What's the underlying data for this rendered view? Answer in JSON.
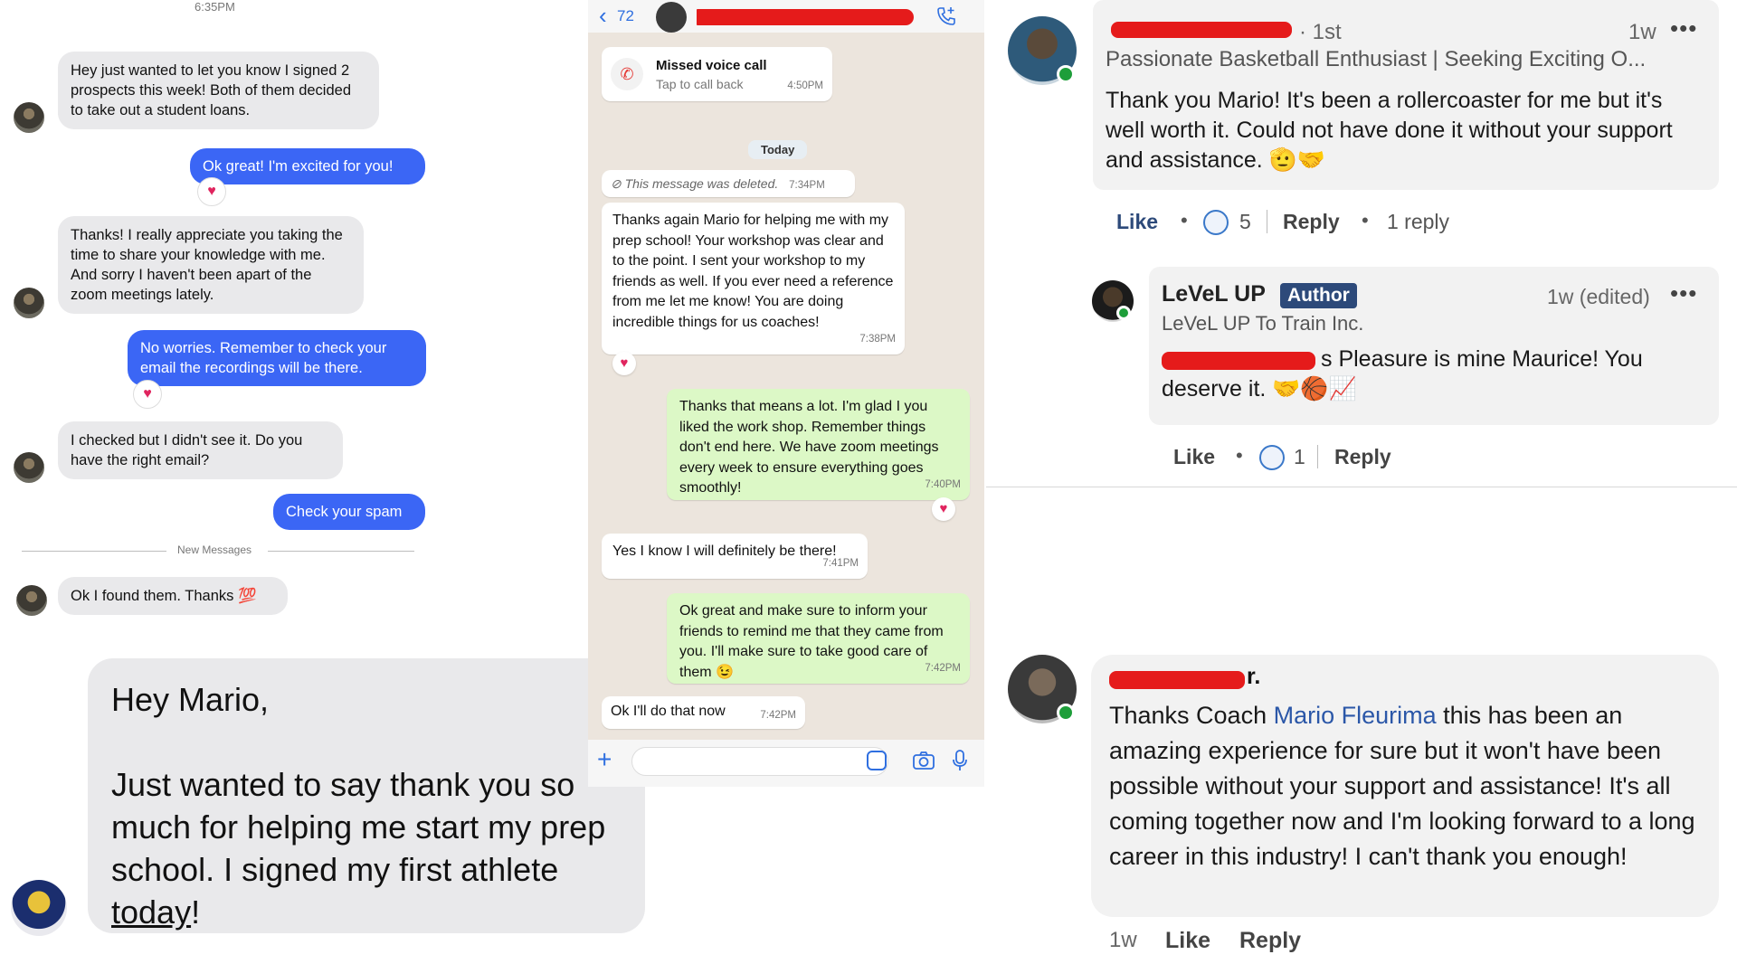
{
  "imessage": {
    "time": "6:35PM",
    "messages": [
      {
        "text": "Hey just wanted to let you know I signed 2 prospects this week! Both of them decided to take out a student loans."
      },
      {
        "text": "Ok great! I'm excited for you!"
      },
      {
        "text": "Thanks! I really appreciate you taking the time to share your knowledge with me. And sorry I haven't been apart of the zoom meetings lately."
      },
      {
        "text": "No worries. Remember to check your email the recordings will be there."
      },
      {
        "text": "I checked but I didn't see it. Do you have the right email?"
      },
      {
        "text": "Check your spam"
      },
      {
        "text": "Ok I found them. Thanks 💯"
      }
    ],
    "divider": "New Messages"
  },
  "large_message": {
    "greeting": "Hey Mario,",
    "body": "Just wanted to say thank you so much for helping me start my prep school. I signed my first athlete",
    "link": "today",
    "end": "!"
  },
  "whatsapp": {
    "back_count": "72",
    "missed_call": {
      "title": "Missed voice call",
      "sub": "Tap to call back",
      "time": "4:50PM"
    },
    "date_chip": "Today",
    "deleted": {
      "text": "This message was deleted.",
      "time": "7:34PM"
    },
    "messages": [
      {
        "text": "Thanks again Mario for helping me with my prep school! Your workshop was clear and to the point. I sent your workshop to my friends as well. If you ever need a reference from me let me know! You are doing incredible things for us coaches!",
        "time": "7:38PM"
      },
      {
        "text": "Thanks that means a lot. I'm glad I you liked the work shop. Remember things don't end here. We have zoom meetings every week to ensure everything goes smoothly!",
        "time": "7:40PM"
      },
      {
        "text": "Yes I know I will definitely be there!",
        "time": "7:41PM"
      },
      {
        "text": "Ok great and make sure to inform your friends to remind me that they came from you. I'll make sure to take good care of them 😉",
        "time": "7:42PM"
      },
      {
        "text": "Ok I'll do that now",
        "time": "7:42PM"
      }
    ]
  },
  "linkedin": {
    "comment1": {
      "degree": "· 1st",
      "headline": "Passionate Basketball Enthusiast | Seeking Exciting O...",
      "age": "1w",
      "text": "Thank you Mario! It's been a rollercoaster for me but it's well worth it. Could not have done it without your support and assistance. 🫡🤝",
      "like": "Like",
      "reactions": "5",
      "reply": "Reply",
      "replies": "1 reply"
    },
    "reply1": {
      "name": "LeVeL UP",
      "badge": "Author",
      "subtitle": "LeVeL UP To Train Inc.",
      "age": "1w (edited)",
      "text_tail": "s Pleasure is mine Maurice! You deserve it. 🤝🏀📈",
      "like": "Like",
      "reactions": "1",
      "reply": "Reply"
    }
  },
  "facebook": {
    "name_tail": "r.",
    "text_pre": "Thanks Coach ",
    "mention": "Mario Fleurima",
    "text_post": " this has been an amazing experience for sure but it won't have been possible without your support and assistance! It's all coming together now and I'm looking forward to a long career in this industry! I can't thank you enough!",
    "age": "1w",
    "like": "Like",
    "reply": "Reply"
  },
  "icons": [
    "back-chevron-icon",
    "phone-plus-icon",
    "missed-call-icon",
    "plus-icon",
    "sticker-icon",
    "camera-icon",
    "mic-icon",
    "more-icon",
    "reaction-icon",
    "heart-icon"
  ],
  "colors": {
    "imessage_blue": "#3b66f5",
    "whatsapp_out": "#dcf8c6",
    "whatsapp_bg": "#ece5dd",
    "redaction": "#e51b1b",
    "linkedin_author": "#2d4a7a",
    "mention": "#2b57a8"
  }
}
